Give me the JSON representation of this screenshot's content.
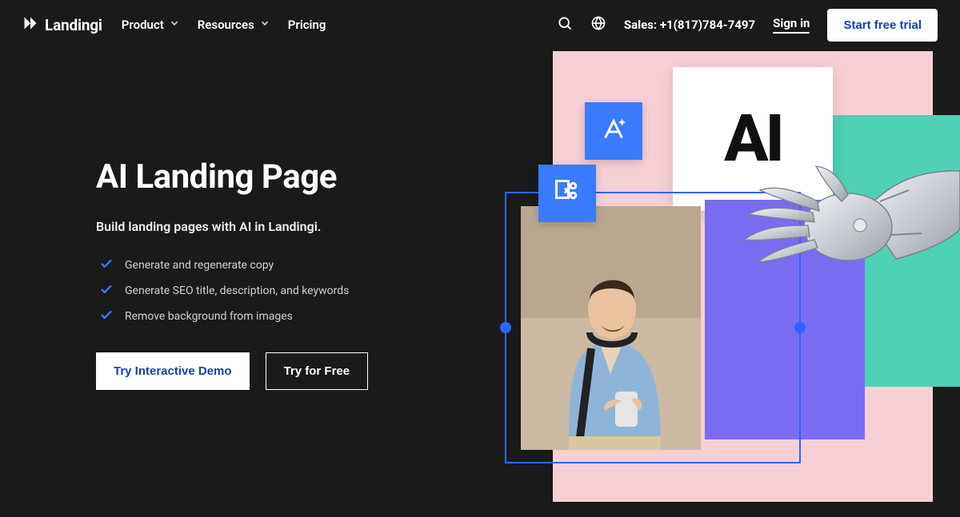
{
  "brand": {
    "name": "Landingi"
  },
  "nav": {
    "items": [
      {
        "label": "Product"
      },
      {
        "label": "Resources"
      },
      {
        "label": "Pricing"
      }
    ]
  },
  "header": {
    "sales_label": "Sales: +1(817)784-7497",
    "signin_label": "Sign in",
    "cta_label": "Start free trial"
  },
  "hero": {
    "title": "AI Landing Page",
    "subtitle": "Build landing pages with AI in Landingi.",
    "features": [
      "Generate and regenerate copy",
      "Generate SEO title, description, and keywords",
      "Remove background from images"
    ],
    "primary_cta": "Try Interactive Demo",
    "secondary_cta": "Try for Free"
  },
  "graphic": {
    "ai_text": "AI"
  }
}
